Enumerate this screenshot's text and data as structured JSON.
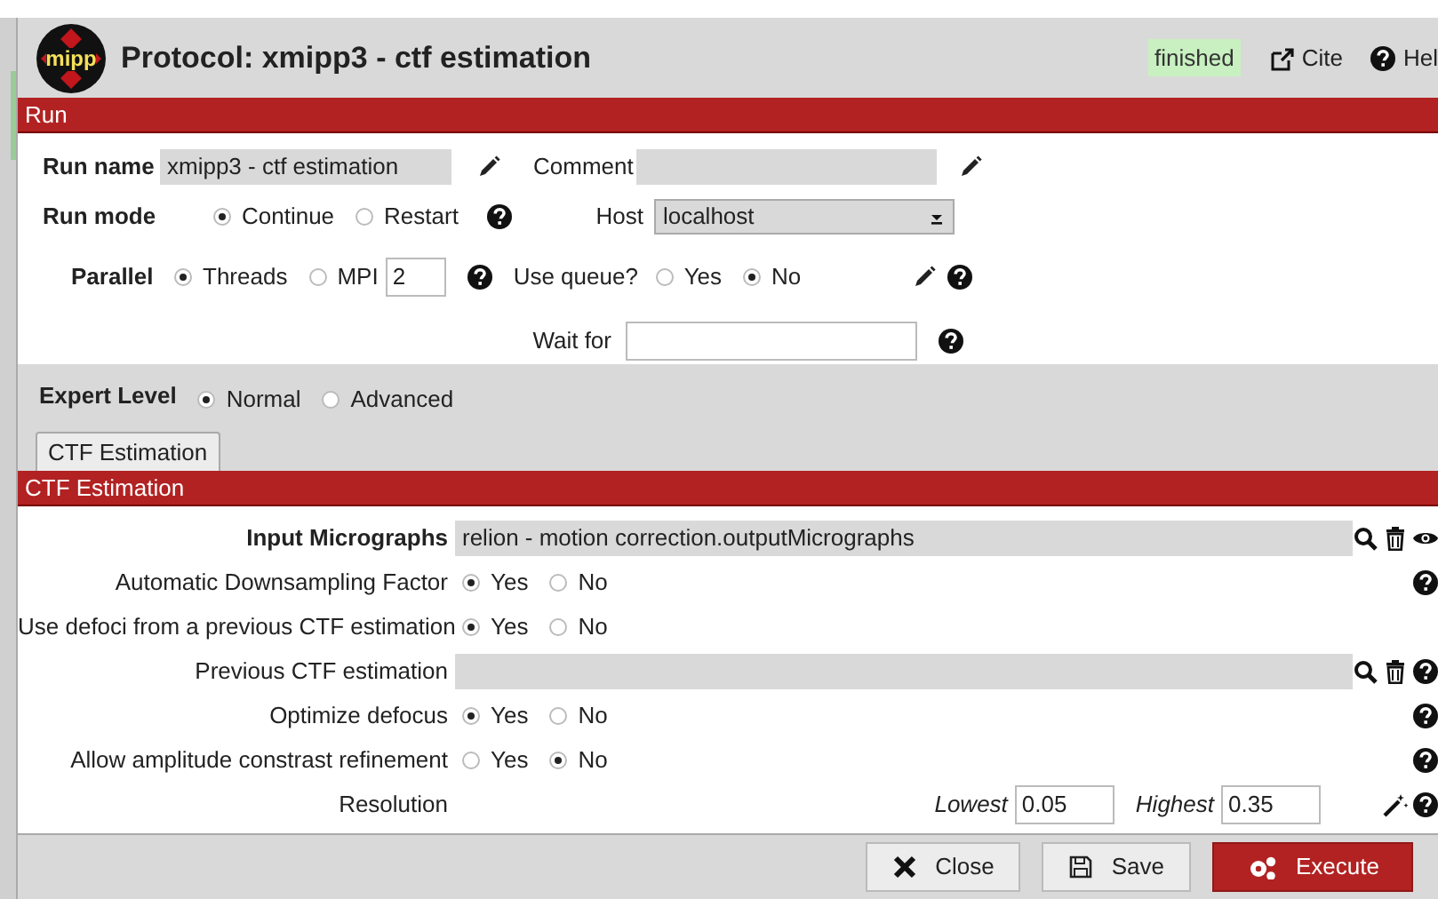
{
  "header": {
    "logo_text": "mipp",
    "title": "Protocol: xmipp3 - ctf estimation",
    "status": "finished",
    "links": [
      {
        "label": "Cite",
        "kind": "cite"
      },
      {
        "label": "Hel",
        "kind": "help"
      }
    ]
  },
  "run": {
    "title": "Run",
    "run_name": {
      "label": "Run name",
      "value": "xmipp3 - ctf estimation"
    },
    "comment": {
      "label": "Comment"
    },
    "run_mode": {
      "label": "Run mode",
      "options": [
        {
          "label": "Continue",
          "selected": true
        },
        {
          "label": "Restart",
          "selected": false
        }
      ]
    },
    "host": {
      "label": "Host",
      "value": "localhost"
    },
    "parallel": {
      "label": "Parallel",
      "options": [
        {
          "label": "Threads",
          "selected": true
        },
        {
          "label": "MPI",
          "selected": false
        }
      ],
      "mpi_value": "2"
    },
    "use_queue": {
      "label": "Use queue?",
      "options": [
        {
          "label": "Yes",
          "selected": false
        },
        {
          "label": "No",
          "selected": true
        }
      ]
    },
    "wait_for": {
      "label": "Wait for"
    }
  },
  "expert_level": {
    "label": "Expert Level",
    "options": [
      {
        "label": "Normal",
        "selected": true
      },
      {
        "label": "Advanced",
        "selected": false
      }
    ]
  },
  "tabs": [
    {
      "label": "CTF Estimation",
      "selected": true
    }
  ],
  "section": {
    "title": "CTF Estimation",
    "params": [
      {
        "kind": "pointer",
        "label": "Input Micrographs",
        "important": true,
        "value": "relion - motion correction.outputMicrographs",
        "preview": true,
        "help": false
      },
      {
        "kind": "radio",
        "label": "Automatic Downsampling Factor",
        "options": [
          {
            "label": "Yes",
            "selected": true
          },
          {
            "label": "No",
            "selected": false
          }
        ],
        "help": true
      },
      {
        "kind": "radio",
        "label": "Use defoci from a previous CTF estimation",
        "options": [
          {
            "label": "Yes",
            "selected": true
          },
          {
            "label": "No",
            "selected": false
          }
        ],
        "help": false
      },
      {
        "kind": "pointer",
        "label": "Previous CTF estimation",
        "important": false,
        "preview": false,
        "help": true
      },
      {
        "kind": "radio",
        "label": "Optimize defocus",
        "options": [
          {
            "label": "Yes",
            "selected": true
          },
          {
            "label": "No",
            "selected": false
          }
        ],
        "help": true
      },
      {
        "kind": "radio",
        "label": "Allow amplitude constrast refinement",
        "options": [
          {
            "label": "Yes",
            "selected": false
          },
          {
            "label": "No",
            "selected": true
          }
        ],
        "help": true
      },
      {
        "kind": "range",
        "label": "Resolution",
        "lowest_label": "Lowest",
        "lowest_value": "0.05",
        "highest_label": "Highest",
        "highest_value": "0.35",
        "help": true
      }
    ]
  },
  "buttons": [
    {
      "label": "Close",
      "kind": "close"
    },
    {
      "label": "Save",
      "kind": "save"
    },
    {
      "label": "Execute",
      "kind": "execute"
    }
  ]
}
